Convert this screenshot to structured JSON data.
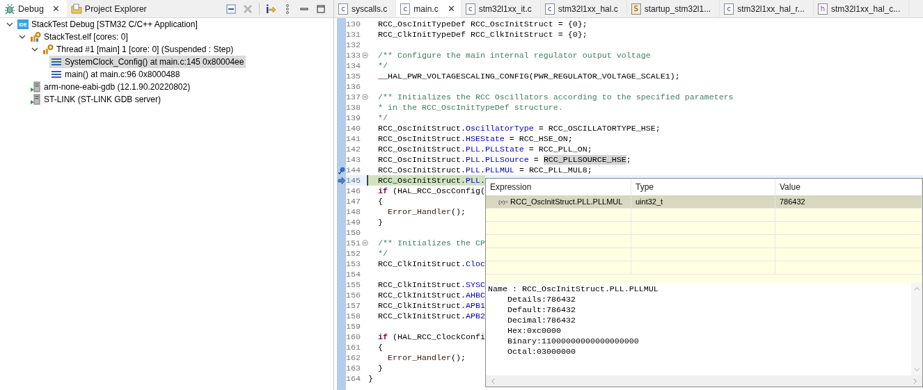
{
  "debug_view": {
    "tabs": [
      {
        "label": "Debug",
        "selected": true,
        "close": "✕"
      },
      {
        "label": "Project Explorer",
        "selected": false
      }
    ],
    "tree": [
      {
        "label": "StackTest Debug [STM32 C/C++ Application]",
        "kind": "launch",
        "icon_text": "IDE",
        "expanded": true,
        "selected": false,
        "children": [
          {
            "label": "StackTest.elf [cores: 0]",
            "kind": "process",
            "expanded": true,
            "selected": false,
            "children": [
              {
                "label": "Thread #1 [main] 1 [core: 0] (Suspended : Step)",
                "kind": "thread",
                "expanded": true,
                "selected": false,
                "children": [
                  {
                    "label": "SystemClock_Config() at main.c:145 0x80004ee",
                    "kind": "frame",
                    "selected": true
                  },
                  {
                    "label": "main() at main.c:96 0x8000488",
                    "kind": "frame",
                    "selected": false
                  }
                ]
              }
            ]
          },
          {
            "label": "arm-none-eabi-gdb (12.1.90.20220802)",
            "kind": "server",
            "selected": false
          },
          {
            "label": "ST-LINK (ST-LINK GDB server)",
            "kind": "server",
            "selected": false
          }
        ]
      }
    ]
  },
  "editor": {
    "tabs": [
      {
        "label": "syscalls.c",
        "icon_letter": "c",
        "selected": false
      },
      {
        "label": "main.c",
        "icon_letter": "c",
        "selected": true,
        "close": "✕"
      },
      {
        "label": "stm32l1xx_it.c",
        "icon_letter": "c",
        "selected": false
      },
      {
        "label": "stm32l1xx_hal.c",
        "icon_letter": "c",
        "selected": false
      },
      {
        "label": "startup_stm32l1...",
        "icon_letter": "S",
        "selected": false
      },
      {
        "label": "stm32l1xx_hal_r...",
        "icon_letter": "c",
        "selected": false
      },
      {
        "label": "stm32l1xx_hal_c...",
        "icon_letter": "h",
        "selected": false
      }
    ],
    "lines": [
      {
        "number": "130",
        "tokens": [
          {
            "text": "  RCC_OscInitTypeDef RCC_OscInitStruct = {0};",
            "kind": "plain"
          }
        ]
      },
      {
        "number": "131",
        "tokens": [
          {
            "text": "  RCC_ClkInitTypeDef RCC_ClkInitStruct = {0};",
            "kind": "plain"
          }
        ]
      },
      {
        "number": "132"
      },
      {
        "number": "133",
        "kind": "fold",
        "tokens": [
          {
            "text": "  /** Configure the main internal regulator output voltage",
            "kind": "comment"
          }
        ]
      },
      {
        "number": "134",
        "tokens": [
          {
            "text": "  */",
            "kind": "comment"
          }
        ]
      },
      {
        "number": "135",
        "tokens": [
          {
            "text": "  __HAL_PWR_VOLTAGESCALING_CONFIG(PWR_REGULATOR_VOLTAGE_SCALE1);",
            "kind": "plain"
          }
        ]
      },
      {
        "number": "136"
      },
      {
        "number": "137",
        "kind": "fold",
        "tokens": [
          {
            "text": "  /** Initializes the RCC Oscillators according to the specified parameters",
            "kind": "comment"
          }
        ]
      },
      {
        "number": "138",
        "tokens": [
          {
            "text": "  * in the RCC_OscInitTypeDef structure.",
            "kind": "comment"
          }
        ]
      },
      {
        "number": "139",
        "tokens": [
          {
            "text": "  */",
            "kind": "comment"
          }
        ]
      },
      {
        "number": "140",
        "tokens": [
          {
            "text": "  RCC_OscInitStruct.",
            "kind": "plain"
          },
          {
            "text": "OscillatorType",
            "kind": "field"
          },
          {
            "text": " = RCC_OSCILLATORTYPE_HSE;",
            "kind": "plain"
          }
        ]
      },
      {
        "number": "141",
        "tokens": [
          {
            "text": "  RCC_OscInitStruct.",
            "kind": "plain"
          },
          {
            "text": "HSEState",
            "kind": "field"
          },
          {
            "text": " = RCC_HSE_ON;",
            "kind": "plain"
          }
        ]
      },
      {
        "number": "142",
        "tokens": [
          {
            "text": "  RCC_OscInitStruct.",
            "kind": "plain"
          },
          {
            "text": "PLL",
            "kind": "field"
          },
          {
            "text": ".",
            "kind": "plain"
          },
          {
            "text": "PLLState",
            "kind": "field"
          },
          {
            "text": " = RCC_PLL_ON;",
            "kind": "plain"
          }
        ]
      },
      {
        "number": "143",
        "tokens": [
          {
            "text": "  RCC_OscInitStruct.",
            "kind": "plain"
          },
          {
            "text": "PLL",
            "kind": "field"
          },
          {
            "text": ".",
            "kind": "plain"
          },
          {
            "text": "PLLSource",
            "kind": "field"
          },
          {
            "text": " = ",
            "kind": "plain"
          },
          {
            "text": "RCC_PLLSOURCE_HSE",
            "kind": "occurrence"
          },
          {
            "text": ";",
            "kind": "plain"
          }
        ]
      },
      {
        "number": "144",
        "kind": "breakpoint",
        "tokens": [
          {
            "text": "  RCC_OscInitStruct.",
            "kind": "plain"
          },
          {
            "text": "PLL",
            "kind": "field"
          },
          {
            "text": ".",
            "kind": "plain"
          },
          {
            "text": "PLLMUL",
            "kind": "field"
          },
          {
            "text": " = RCC_PLL_MUL8;",
            "kind": "plain"
          }
        ]
      },
      {
        "number": "145",
        "kind": "pointer",
        "current": true,
        "tokens": [
          {
            "text": "  RCC_OscInitStruct.",
            "kind": "plain"
          },
          {
            "text": "PLL",
            "kind": "field"
          },
          {
            "text": ".",
            "kind": "plain"
          }
        ]
      },
      {
        "number": "146",
        "tokens": [
          {
            "text": "  if",
            "kind": "keyword"
          },
          {
            "text": " (HAL_RCC_OscConfig(",
            "kind": "plain"
          }
        ]
      },
      {
        "number": "147",
        "tokens": [
          {
            "text": "  {",
            "kind": "plain"
          }
        ]
      },
      {
        "number": "148",
        "tokens": [
          {
            "text": "    Error_Handler",
            "kind": "function"
          },
          {
            "text": "();",
            "kind": "plain"
          }
        ]
      },
      {
        "number": "149",
        "tokens": [
          {
            "text": "  }",
            "kind": "plain"
          }
        ]
      },
      {
        "number": "150"
      },
      {
        "number": "151",
        "kind": "fold",
        "tokens": [
          {
            "text": "  /** Initializes the CP",
            "kind": "comment"
          }
        ]
      },
      {
        "number": "152",
        "tokens": [
          {
            "text": "  */",
            "kind": "comment"
          }
        ]
      },
      {
        "number": "153",
        "tokens": [
          {
            "text": "  RCC_ClkInitStruct.",
            "kind": "plain"
          },
          {
            "text": "Cloc",
            "kind": "field"
          }
        ]
      },
      {
        "number": "154"
      },
      {
        "number": "155",
        "tokens": [
          {
            "text": "  RCC_ClkInitStruct.",
            "kind": "plain"
          },
          {
            "text": "SYSC",
            "kind": "field"
          }
        ]
      },
      {
        "number": "156",
        "tokens": [
          {
            "text": "  RCC_ClkInitStruct.",
            "kind": "plain"
          },
          {
            "text": "AHBC",
            "kind": "field"
          }
        ]
      },
      {
        "number": "157",
        "tokens": [
          {
            "text": "  RCC_ClkInitStruct.",
            "kind": "plain"
          },
          {
            "text": "APB1",
            "kind": "field"
          }
        ]
      },
      {
        "number": "158",
        "tokens": [
          {
            "text": "  RCC_ClkInitStruct.",
            "kind": "plain"
          },
          {
            "text": "APB2",
            "kind": "field"
          }
        ]
      },
      {
        "number": "159"
      },
      {
        "number": "160",
        "tokens": [
          {
            "text": "  if",
            "kind": "keyword"
          },
          {
            "text": " (HAL_RCC_ClockConfi",
            "kind": "plain"
          }
        ]
      },
      {
        "number": "161",
        "tokens": [
          {
            "text": "  {",
            "kind": "plain"
          }
        ]
      },
      {
        "number": "162",
        "tokens": [
          {
            "text": "    Error_Handler",
            "kind": "function"
          },
          {
            "text": "();",
            "kind": "plain"
          }
        ]
      },
      {
        "number": "163",
        "tokens": [
          {
            "text": "  }",
            "kind": "plain"
          }
        ]
      },
      {
        "number": "164",
        "tokens": [
          {
            "text": "}",
            "kind": "plain"
          }
        ]
      }
    ],
    "hover": {
      "columns": [
        "Expression",
        "Type",
        "Value"
      ],
      "rows": [
        {
          "icon": "(x)=",
          "expression": "RCC_OscInitStruct.PLL.PLLMUL",
          "type": "uint32_t",
          "value": "786432",
          "selected": true
        }
      ],
      "details": [
        "Name : RCC_OscInitStruct.PLL.PLLMUL",
        "    Details:786432",
        "    Default:786432",
        "    Decimal:786432",
        "    Hex:0xc0000",
        "    Binary:11000000000000000000",
        "    Octal:03000000"
      ]
    }
  }
}
